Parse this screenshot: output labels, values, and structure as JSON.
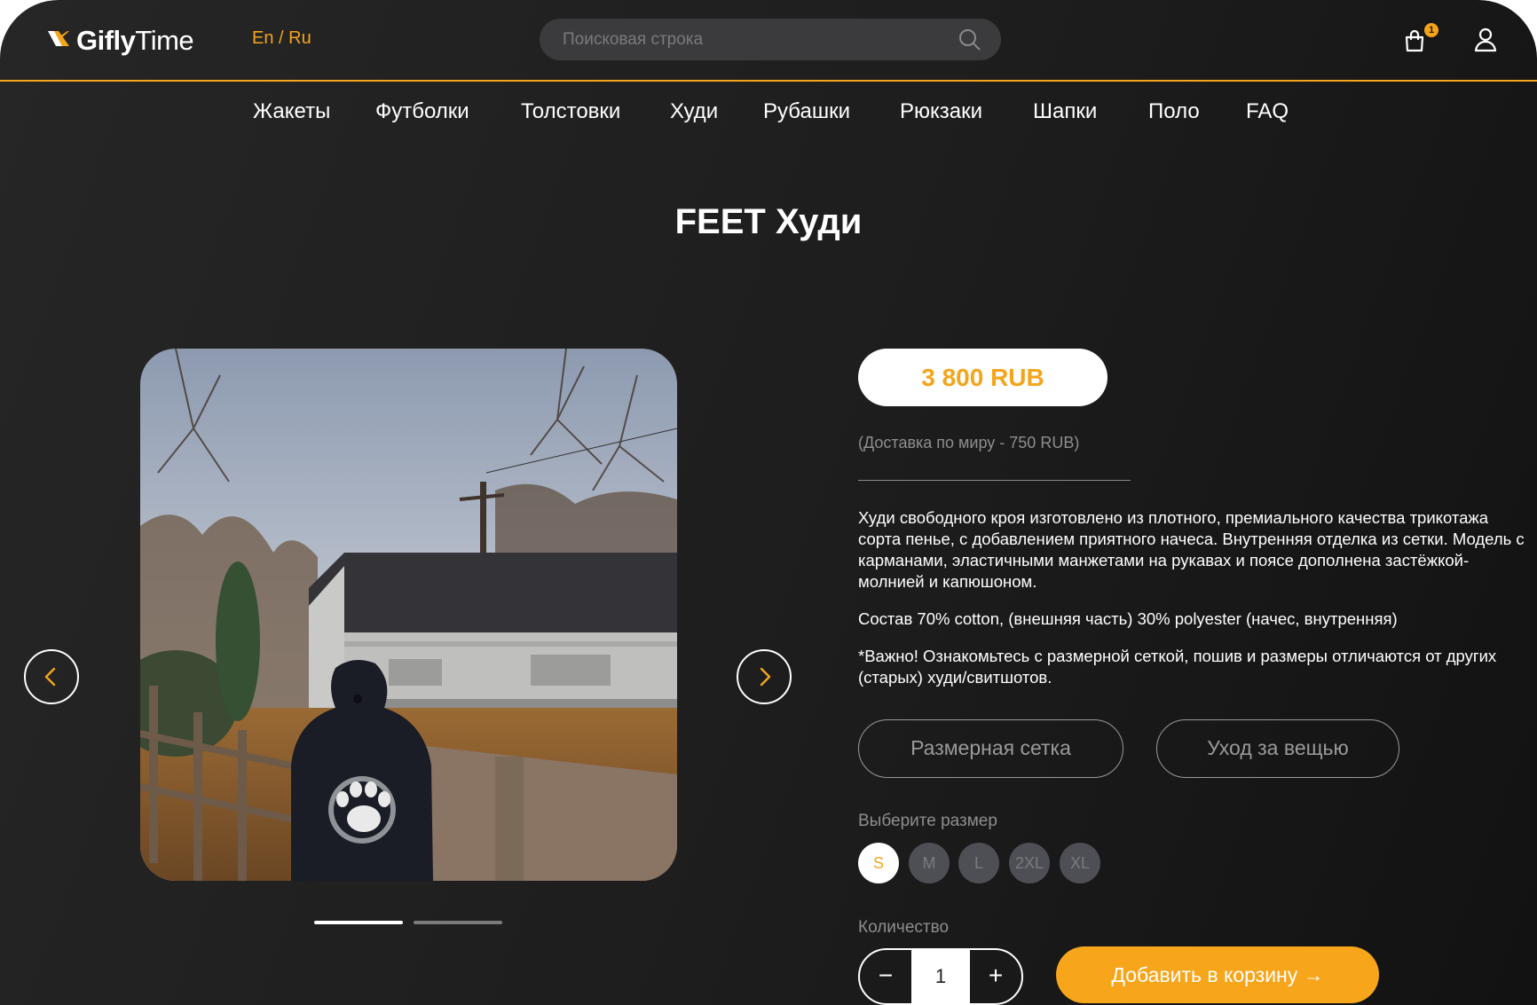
{
  "header": {
    "logo_bold": "Gifly",
    "logo_light": "Time",
    "lang_en": "En",
    "lang_sep": " / ",
    "lang_ru": "Ru",
    "search_placeholder": "Поисковая строка",
    "cart_count": "1"
  },
  "nav": {
    "items": [
      "Жакеты",
      "Футболки",
      "Толстовки",
      "Худи",
      "Рубашки",
      "Рюкзаки",
      "Шапки",
      "Поло",
      "FAQ"
    ]
  },
  "product": {
    "title": "FEET Худи",
    "price": "3 800 RUB",
    "delivery": "(Доставка по миру - 750 RUB)",
    "description": [
      "Худи свободного кроя изготовлено из плотного, премиального качества трикотажа сорта пенье, с добавлением приятного начеса. Внутренняя отделка из сетки. Модель с карманами, эластичными манжетами на рукавах и поясе дополнена застёжкой-молнией и капюшоном.",
      "Состав 70% cotton, (внешняя часть) 30% polyester (начес, внутренняя)",
      "*Важно! Ознакомьтесь с размерной сеткой, пошив и размеры отличаются от других (старых) худи/свитшотов."
    ],
    "size_chart_label": "Размерная сетка",
    "care_label": "Уход за вещью",
    "size_label": "Выберите размер",
    "sizes": [
      "S",
      "M",
      "L",
      "2XL",
      "XL"
    ],
    "selected_size": "S",
    "quantity_label": "Количество",
    "quantity": "1",
    "minus_label": "−",
    "plus_label": "+",
    "add_to_cart": "Добавить в корзину →"
  },
  "gallery": {
    "slide_count": 2,
    "active_slide": 1
  },
  "colors": {
    "accent": "#f4a51c",
    "background": "#1d1d1d",
    "size_inactive": "#4e4e55"
  },
  "icons": {
    "logo": "logo-mark-icon",
    "search": "search-icon",
    "cart": "shopping-bag-icon",
    "user": "user-icon",
    "prev": "chevron-left-icon",
    "next": "chevron-right-icon"
  }
}
